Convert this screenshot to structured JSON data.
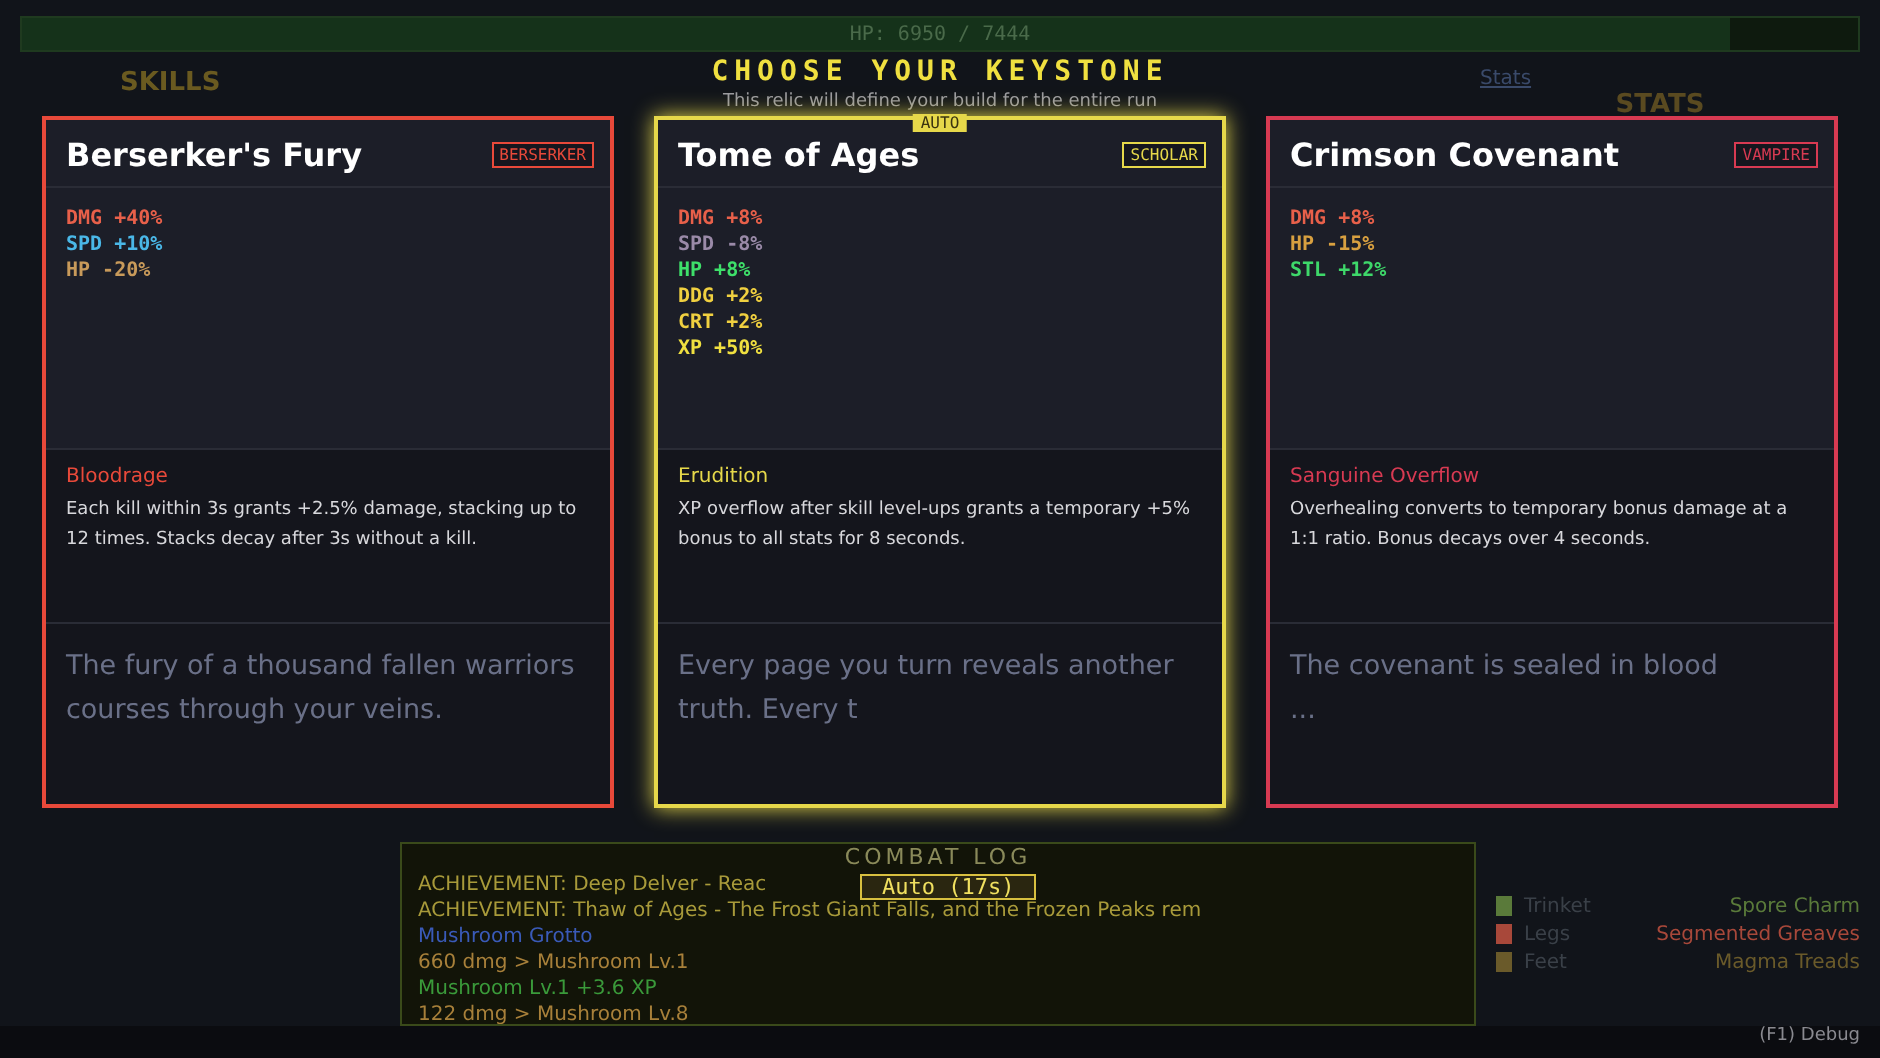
{
  "hp_bar": {
    "label": "HP: 6950 / 7444",
    "level": 0.93
  },
  "skills_panel": {
    "title": "SKILLS"
  },
  "stats_panel": {
    "tab": "Stats",
    "title": "STATS"
  },
  "modal": {
    "title": "CHOOSE YOUR KEYSTONE",
    "subtitle": "This relic will define your build for the entire run",
    "cards": [
      {
        "name": "Berserker's Fury",
        "tag": "BERSERKER",
        "color": "#e8493a",
        "selected": false,
        "stats": [
          {
            "text": "DMG +40%",
            "color": "#e8604a"
          },
          {
            "text": "SPD +10%",
            "color": "#4ab8e8"
          },
          {
            "text": "HP -20%",
            "color": "#c89a5a"
          }
        ],
        "ability": {
          "name": "Bloodrage",
          "text": "Each kill within 3s grants +2.5% damage, stacking up to 12 times. Stacks decay after 3s without a kill."
        },
        "flavor": "The fury of a thousand fallen warriors courses through your veins."
      },
      {
        "name": "Tome of Ages",
        "tag": "SCHOLAR",
        "color": "#e6d84a",
        "selected": true,
        "badge": "AUTO",
        "stats": [
          {
            "text": "DMG +8%",
            "color": "#e8604a"
          },
          {
            "text": "SPD -8%",
            "color": "#9a8aa8"
          },
          {
            "text": "HP +8%",
            "color": "#3ee06a"
          },
          {
            "text": "DDG +2%",
            "color": "#f0d040"
          },
          {
            "text": "CRT +2%",
            "color": "#f0d040"
          },
          {
            "text": "XP +50%",
            "color": "#f0e040"
          }
        ],
        "ability": {
          "name": "Erudition",
          "text": "XP overflow after skill level-ups grants a temporary +5% bonus to all stats for 8 seconds."
        },
        "flavor": "Every page you turn reveals another truth. Every t"
      },
      {
        "name": "Crimson Covenant",
        "tag": "VAMPIRE",
        "color": "#d83a52",
        "selected": false,
        "stats": [
          {
            "text": "DMG +8%",
            "color": "#e8604a"
          },
          {
            "text": "HP -15%",
            "color": "#d8a040"
          },
          {
            "text": "STL +12%",
            "color": "#3ed86a"
          }
        ],
        "ability": {
          "name": "Sanguine Overflow",
          "text": "Overhealing converts to temporary bonus damage at a 1:1 ratio. Bonus decays over 4 seconds."
        },
        "flavor": "The covenant is sealed in blood\n..."
      }
    ]
  },
  "combat_log": {
    "title": "COMBAT LOG",
    "auto_button": "Auto (17s)",
    "lines": [
      {
        "text": "ACHIEVEMENT: Deep Delver - Reac",
        "color": "#a89a3a"
      },
      {
        "text": "ACHIEVEMENT: Thaw of Ages - The Frost Giant Falls, and the Frozen Peaks rem",
        "color": "#a89a3a"
      },
      {
        "text": "Mushroom Grotto",
        "color": "#3a5ab8"
      },
      {
        "text": "660 dmg > Mushroom Lv.1",
        "color": "#a8803a"
      },
      {
        "text": "Mushroom Lv.1 +3.6 XP",
        "color": "#3a9a3a"
      },
      {
        "text": "122 dmg > Mushroom Lv.8",
        "color": "#a8803a"
      }
    ]
  },
  "equipment": [
    {
      "slot": "Trinket",
      "item": "Spore Charm",
      "color": "#5a7a3a"
    },
    {
      "slot": "Legs",
      "item": "Segmented Greaves",
      "color": "#a8483a"
    },
    {
      "slot": "Feet",
      "item": "Magma Treads",
      "color": "#6a5a2a"
    }
  ],
  "debug": "(F1) Debug"
}
